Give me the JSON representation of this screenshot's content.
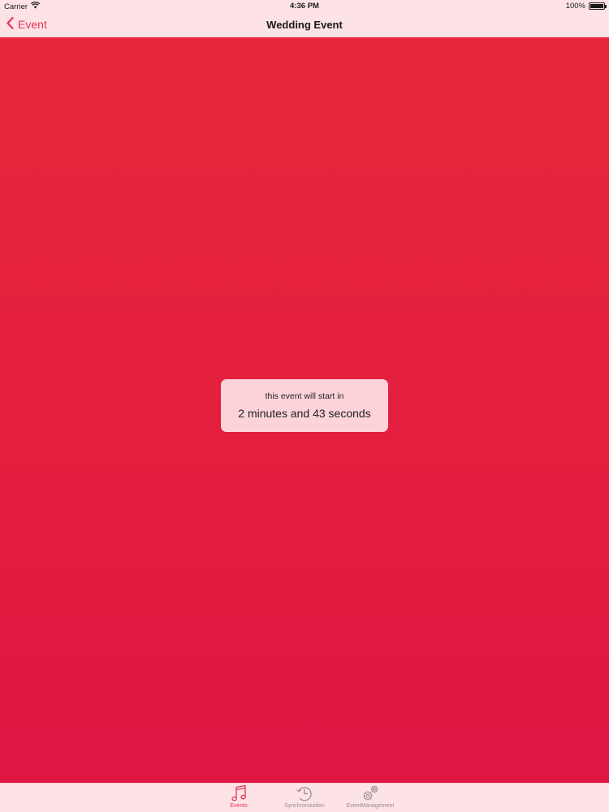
{
  "status_bar": {
    "carrier": "Carrier",
    "time": "4:36 PM",
    "battery_text": "100%",
    "battery_level_percent": 100
  },
  "nav": {
    "back_label": "Event",
    "title": "Wedding Event"
  },
  "countdown": {
    "label": "this event will start in",
    "value": "2 minutes and 43 seconds"
  },
  "tabs": [
    {
      "label": "Events",
      "icon": "music-note-icon",
      "active": true
    },
    {
      "label": "Synchronization",
      "icon": "sync-clock-icon",
      "active": false
    },
    {
      "label": "EventManagement",
      "icon": "gears-icon",
      "active": false
    }
  ],
  "colors": {
    "accent": "#e23556",
    "bar_background": "#fde3e6",
    "gradient_top": "#e8283a",
    "gradient_bottom": "#df1542"
  }
}
